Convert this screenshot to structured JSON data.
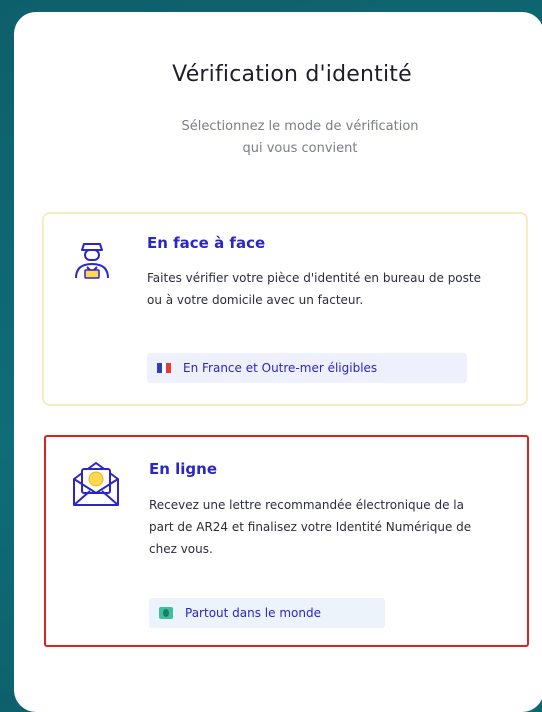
{
  "header": {
    "title": "Vérification d'identité",
    "subtitle_line1": "Sélectionnez le mode de vérification",
    "subtitle_line2": "qui vous convient"
  },
  "options": [
    {
      "title": "En face à face",
      "description": "Faites vérifier votre pièce d'identité en bureau de poste ou à votre domicile avec un facteur.",
      "tag": "En France et Outre-mer éligibles",
      "icon": "postman-icon",
      "tag_icon": "france-flag-icon"
    },
    {
      "title": "En ligne",
      "description": "Recevez une lettre recommandée électronique de la part de AR24 et finalisez votre Identité Numérique de chez vous.",
      "tag": "Partout dans le monde",
      "icon": "envelope-icon",
      "tag_icon": "world-icon",
      "selected": true
    }
  ],
  "colors": {
    "accent": "#2a26c8",
    "selected_border": "#d8231f",
    "background": "#0f6d78",
    "card_border": "#f7ecc5"
  }
}
